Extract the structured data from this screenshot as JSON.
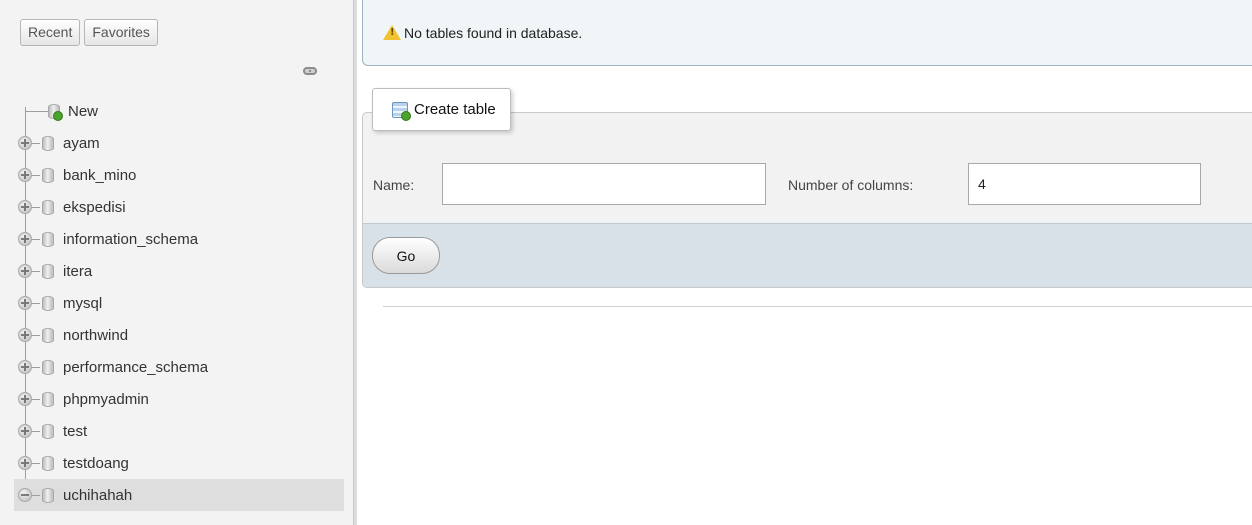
{
  "sidebar": {
    "tabs": [
      {
        "label": "Recent"
      },
      {
        "label": "Favorites"
      }
    ],
    "link_icon": "link-chain-icon",
    "tree": {
      "new_item": {
        "label": "New",
        "icon": "new-database-icon"
      },
      "databases": [
        {
          "label": "ayam",
          "expander": "plus",
          "selected": false
        },
        {
          "label": "bank_mino",
          "expander": "plus",
          "selected": false
        },
        {
          "label": "ekspedisi",
          "expander": "plus",
          "selected": false
        },
        {
          "label": "information_schema",
          "expander": "plus",
          "selected": false
        },
        {
          "label": "itera",
          "expander": "plus",
          "selected": false
        },
        {
          "label": "mysql",
          "expander": "plus",
          "selected": false
        },
        {
          "label": "northwind",
          "expander": "plus",
          "selected": false
        },
        {
          "label": "performance_schema",
          "expander": "plus",
          "selected": false
        },
        {
          "label": "phpmyadmin",
          "expander": "plus",
          "selected": false
        },
        {
          "label": "test",
          "expander": "plus",
          "selected": false
        },
        {
          "label": "testdoang",
          "expander": "plus",
          "selected": false
        },
        {
          "label": "uchihahah",
          "expander": "minus",
          "selected": true
        }
      ]
    }
  },
  "main": {
    "notice": {
      "text": "No tables found in database.",
      "icon": "warning-icon",
      "color": "#f1c232"
    },
    "create_table": {
      "legend": "Create table",
      "name_label": "Name:",
      "name_value": "",
      "columns_label": "Number of columns:",
      "columns_value": "4",
      "go_label": "Go"
    }
  },
  "colors": {
    "sidebar_bg": "#f3f3f3",
    "notice_bg": "#f0f5f8",
    "panel_footer_bg": "#d8e1e7",
    "selected_row_bg": "#dedede"
  }
}
